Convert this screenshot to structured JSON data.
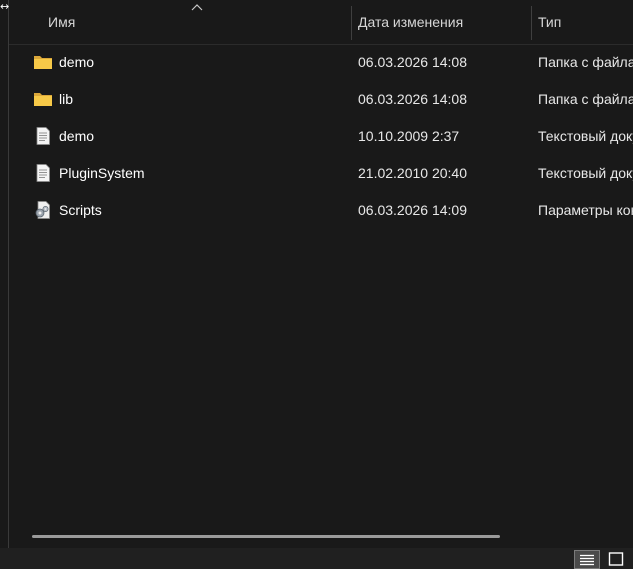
{
  "columns": {
    "name": "Имя",
    "date": "Дата изменения",
    "type": "Тип"
  },
  "files": [
    {
      "name": "demo",
      "date": "06.03.2026 14:08",
      "type": "Папка с файлами",
      "icon": "folder-icon"
    },
    {
      "name": "lib",
      "date": "06.03.2026 14:08",
      "type": "Папка с файлами",
      "icon": "folder-icon"
    },
    {
      "name": "demo",
      "date": "10.10.2009 2:37",
      "type": "Текстовый документ",
      "icon": "text-file-icon"
    },
    {
      "name": "PluginSystem",
      "date": "21.02.2010 20:40",
      "type": "Текстовый документ",
      "icon": "text-file-icon"
    },
    {
      "name": "Scripts",
      "date": "06.03.2026 14:09",
      "type": "Параметры конфигурации",
      "icon": "config-file-icon"
    }
  ],
  "colors": {
    "background": "#191919",
    "folder": "#f7c948",
    "text": "#ffffff"
  },
  "statusbar": {
    "details_view_icon": "details-view-icon",
    "tiles_view_icon": "large-icons-view-icon"
  }
}
